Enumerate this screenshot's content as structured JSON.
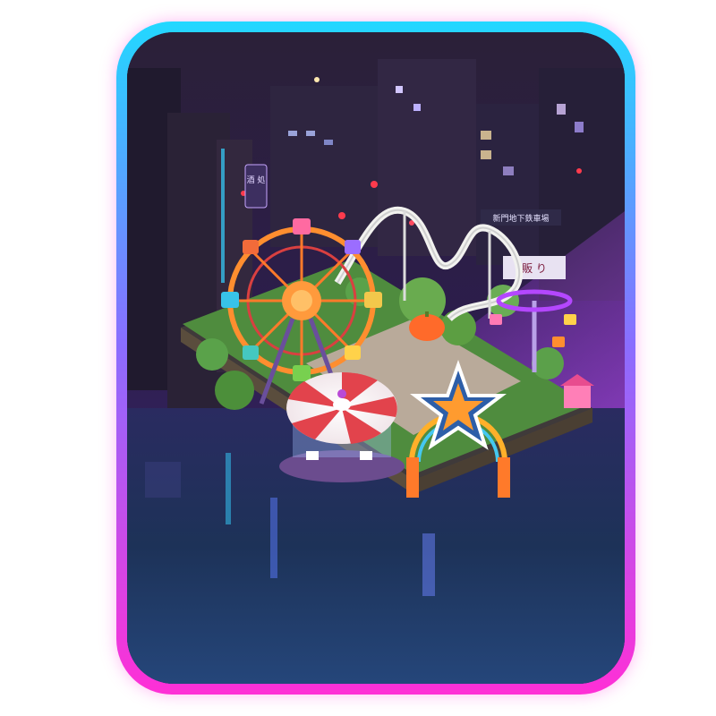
{
  "card": {
    "border_gradient": [
      "#22d8ff",
      "#8a6dff",
      "#ff2fd6"
    ],
    "scene": "night-city-amusement-park"
  },
  "signs": {
    "vertical_sign": "酒 処",
    "station_sign": "新門地下鉄車場",
    "shop_sign": "販 り"
  },
  "icons": {
    "ferris_wheel": "ferris-wheel-icon",
    "carousel": "carousel-icon",
    "roller_coaster": "roller-coaster-icon",
    "star_gate": "star-gate-icon",
    "pumpkin": "pumpkin-icon"
  }
}
